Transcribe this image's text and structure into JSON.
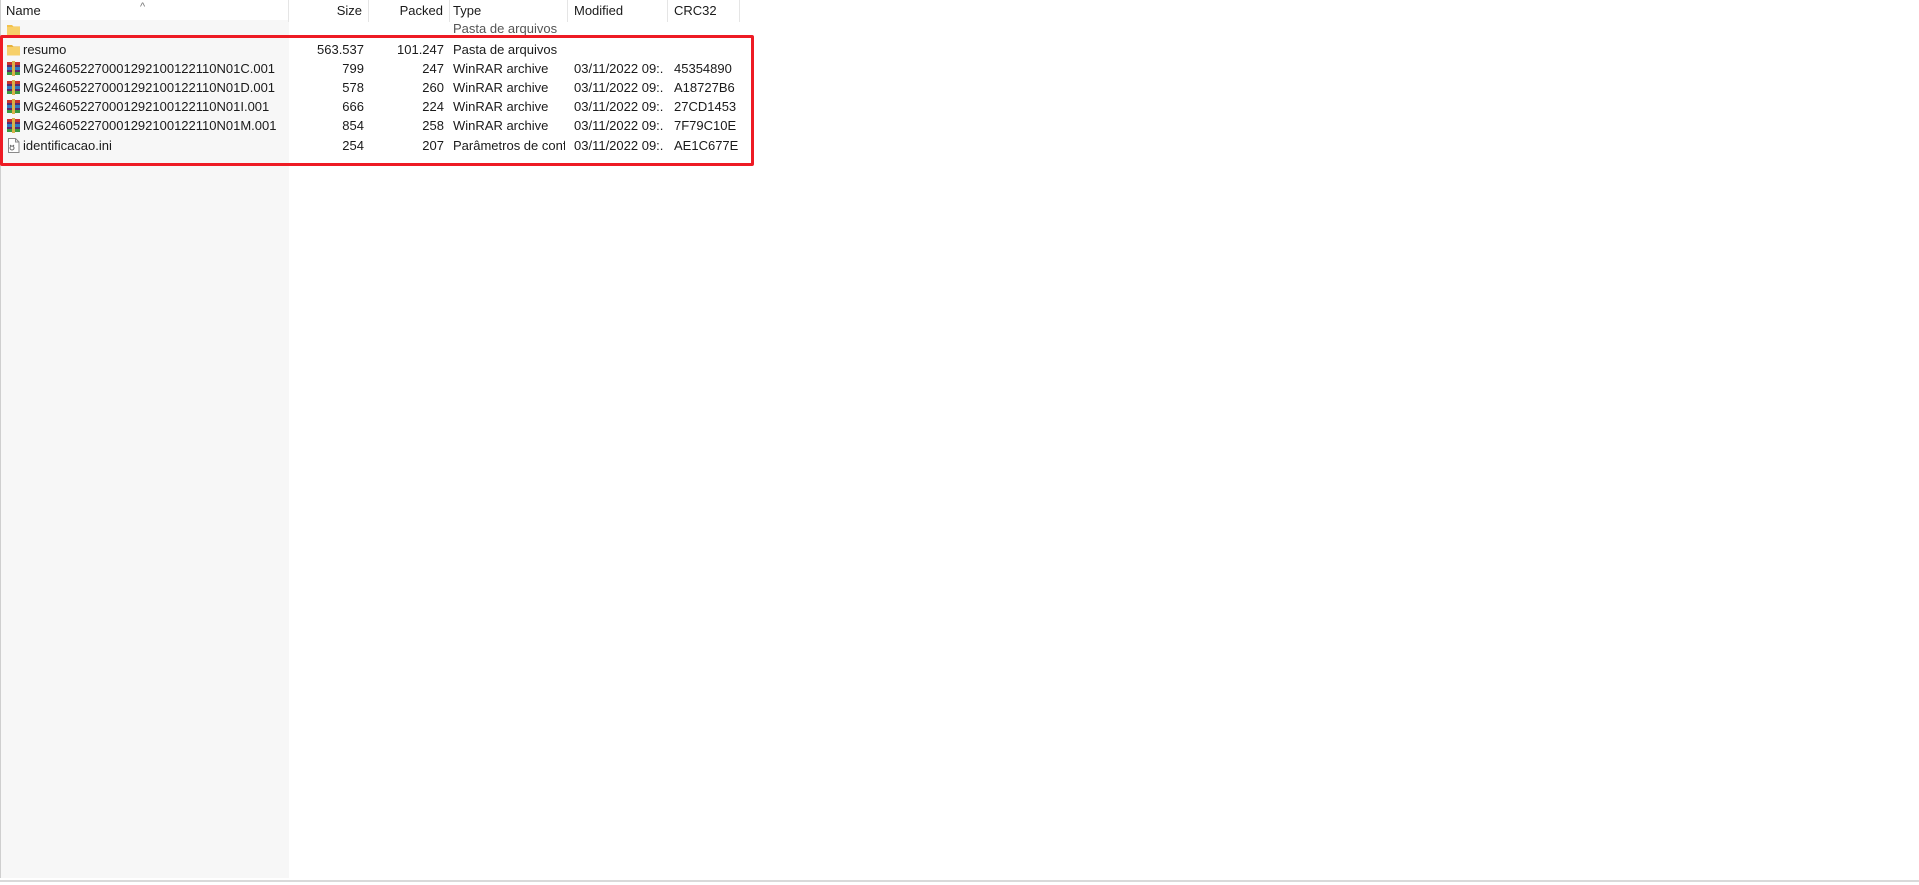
{
  "columns": {
    "name": "Name",
    "size": "Size",
    "packed": "Packed",
    "type": "Type",
    "modified": "Modified",
    "crc": "CRC32"
  },
  "parent_row": {
    "type": "Pasta de arquivos"
  },
  "rows": [
    {
      "name": "resumo",
      "size": "563.537",
      "packed": "101.247",
      "type": "Pasta de arquivos",
      "modified": "",
      "crc": "",
      "icon": "folder-icon"
    },
    {
      "name": "MG246052270001292100122110N01C.001",
      "size": "799",
      "packed": "247",
      "type": "WinRAR archive",
      "modified": "03/11/2022 09:...",
      "crc": "45354890",
      "icon": "winrar-archive-icon"
    },
    {
      "name": "MG246052270001292100122110N01D.001",
      "size": "578",
      "packed": "260",
      "type": "WinRAR archive",
      "modified": "03/11/2022 09:...",
      "crc": "A18727B6",
      "icon": "winrar-archive-icon"
    },
    {
      "name": "MG246052270001292100122110N01I.001",
      "size": "666",
      "packed": "224",
      "type": "WinRAR archive",
      "modified": "03/11/2022 09:...",
      "crc": "27CD1453",
      "icon": "winrar-archive-icon"
    },
    {
      "name": "MG246052270001292100122110N01M.001",
      "size": "854",
      "packed": "258",
      "type": "WinRAR archive",
      "modified": "03/11/2022 09:...",
      "crc": "7F79C10E",
      "icon": "winrar-archive-icon"
    },
    {
      "name": "identificacao.ini",
      "size": "254",
      "packed": "207",
      "type": "Parâmetros de conf...",
      "modified": "03/11/2022 09:...",
      "crc": "AE1C677E",
      "icon": "ini-file-icon"
    }
  ],
  "colors": {
    "highlight": "#ee1b24",
    "folder": "#f3c24b"
  }
}
